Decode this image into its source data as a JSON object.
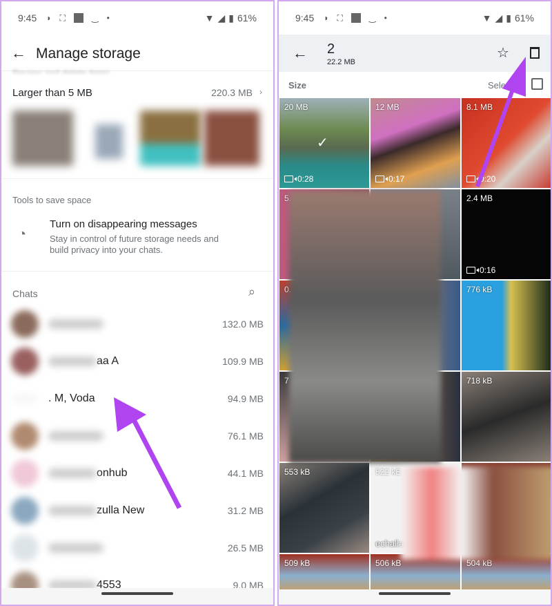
{
  "left": {
    "status": {
      "time": "9:45",
      "battery": "61%"
    },
    "header": {
      "title": "Manage storage"
    },
    "hidden_subtitle": "Review and delete items",
    "larger": {
      "label": "Larger than 5 MB",
      "size": "220.3 MB"
    },
    "tools": {
      "heading": "Tools to save space",
      "item_title": "Turn on disappearing messages",
      "item_desc": "Stay in control of future storage needs and build privacy into your chats."
    },
    "chats": {
      "heading": "Chats",
      "items": [
        {
          "name": "",
          "size": "132.0 MB",
          "avatar": "#8a6a5a"
        },
        {
          "name": "aa A",
          "size": "109.9 MB",
          "avatar": "#9a6060"
        },
        {
          "name": ". M, Voda",
          "size": "94.9 MB",
          "avatar": ""
        },
        {
          "name": "",
          "size": "76.1 MB",
          "avatar": "#b08a70"
        },
        {
          "name": "onhub",
          "size": "44.1 MB",
          "avatar": "#f0c8d8"
        },
        {
          "name": "zulla New",
          "size": "31.2 MB",
          "avatar": "#8aa8c0"
        },
        {
          "name": "",
          "size": "26.5 MB",
          "avatar": "#dde4e8"
        },
        {
          "name": "4553",
          "size": "9.0 MB",
          "avatar": "#a89080"
        }
      ]
    }
  },
  "right": {
    "status": {
      "time": "9:45",
      "battery": "61%"
    },
    "selection": {
      "count": "2",
      "size": "22.2 MB"
    },
    "sort_label": "Size",
    "select_all": "Sele",
    "tiles": [
      {
        "label": "20 MB",
        "duration": "0:28",
        "selected": true,
        "bg": "linear-gradient(180deg,#9fb0b8 0%,#6c8a50 35%,#5a6a50 55%,#2a8a88 75%,#2b9a96 100%)"
      },
      {
        "label": "12 MB",
        "duration": "0:17",
        "bg": "linear-gradient(160deg,#c08a90 0%,#d070c0 35%,#3a2a2a 50%,#e0a050 75%,#8090a0 100%)"
      },
      {
        "label": "8.1 MB",
        "duration": "0:20",
        "bg": "linear-gradient(135deg,#c83020 0%,#e04a30 50%,#d8d0c8 70%,#c83a30 100%)"
      },
      {
        "label": "5.",
        "duration": "",
        "bg": "linear-gradient(90deg,#c05a80 0%,#8a5060 100%)"
      },
      {
        "label": "",
        "duration": "",
        "bg": "linear-gradient(180deg,#7a8088,#505860)"
      },
      {
        "label": "2.4 MB",
        "duration": "0:16",
        "bg": "#050505"
      },
      {
        "label": "0.",
        "duration": "",
        "bg": "linear-gradient(180deg,#c04030,#2a6aa0,#d0a030)"
      },
      {
        "label": "",
        "duration": "",
        "bg": "linear-gradient(90deg,#c89a60,#3a5a8a)"
      },
      {
        "label": "776 kB",
        "duration": "",
        "bg": "linear-gradient(90deg,#2aa0e0 0%,#2aa0e0 45%,#d8c050 55%,#1a2a1a 100%)"
      },
      {
        "label": "7",
        "duration": "",
        "bg": "linear-gradient(180deg,#3a3a3a,#d0a0a0)"
      },
      {
        "label": "",
        "duration": "",
        "bg": "linear-gradient(90deg,#c08a40,#2a3040)"
      },
      {
        "label": "718 kB",
        "duration": "",
        "bg": "linear-gradient(160deg,#8a8078 0%,#2a2a2a 50%,#8a8078 100%)"
      },
      {
        "label": "553 kB",
        "duration": "",
        "bg": "linear-gradient(150deg,#8a8078 0%,#2a3238 40%,#3a4248 70%,#9a8a80 100%)"
      },
      {
        "label": "522 kB",
        "caption": "echalla",
        "duration": "",
        "bg": "#f2f2f2"
      },
      {
        "label": "",
        "duration": "",
        "bg": "linear-gradient(180deg,#8a4030,#c0d0e0,#a07050)"
      },
      {
        "label": "509 kB",
        "duration": "",
        "bg": "linear-gradient(180deg,#a03020 0%,#8ab0d0 60%,#c0a070 100%)"
      },
      {
        "label": "506 kB",
        "duration": "",
        "bg": "linear-gradient(180deg,#a03020 0%,#8ab0d0 60%,#c0a070 100%)"
      },
      {
        "label": "504 kB",
        "duration": "",
        "bg": "linear-gradient(180deg,#a03020 0%,#8ab0d0 60%,#c0a070 100%)"
      }
    ]
  },
  "annotation_color": "#b044f0"
}
